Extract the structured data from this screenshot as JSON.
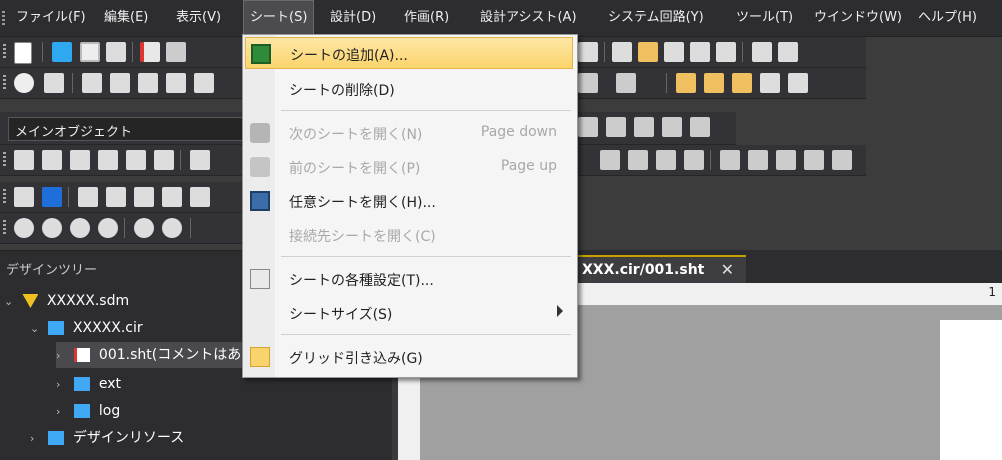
{
  "menubar": {
    "items": [
      "ファイル(F)",
      "編集(E)",
      "表示(V)",
      "シート(S)",
      "設計(D)",
      "作画(R)",
      "設計アシスト(A)",
      "システム回路(Y)",
      "ツール(T)",
      "ウインドウ(W)",
      "ヘルプ(H)"
    ],
    "active_index": 3
  },
  "toolbar": {
    "object_combo": "メインオブジェクト"
  },
  "sheet_menu": {
    "items": [
      {
        "label": "シートの追加(A)...",
        "icon": "add-sheet-icon",
        "enabled": true,
        "highlighted": true
      },
      {
        "label": "シートの削除(D)",
        "enabled": true
      },
      {
        "label": "次のシートを開く(N)",
        "shortcut": "Page down",
        "icon": "next-sheet-icon",
        "enabled": false
      },
      {
        "label": "前のシートを開く(P)",
        "shortcut": "Page up",
        "icon": "prev-sheet-icon",
        "enabled": false
      },
      {
        "label": "任意シートを開く(H)...",
        "icon": "open-sheet-icon",
        "enabled": true
      },
      {
        "label": "接続先シートを開く(C)",
        "enabled": false
      },
      {
        "label": "シートの各種設定(T)...",
        "icon": "sheet-settings-icon",
        "enabled": true
      },
      {
        "label": "シートサイズ(S)",
        "enabled": true,
        "submenu": true
      },
      {
        "label": "グリッド引き込み(G)",
        "icon": "grid-snap-icon",
        "enabled": true
      }
    ]
  },
  "design_tree": {
    "title": "デザインツリー",
    "nodes": [
      {
        "label": "XXXXX.sdm"
      },
      {
        "label": "XXXXX.cir"
      },
      {
        "label": "001.sht(コメントはあ"
      },
      {
        "label": "ext"
      },
      {
        "label": "log"
      },
      {
        "label": "デザインリソース"
      }
    ]
  },
  "document": {
    "tab_label": "XXX.cir/001.sht",
    "close_glyph": "✕",
    "ruler_number": "1"
  },
  "colors": {
    "highlight": "#fbd46b",
    "folder": "#3fa9f5",
    "accent_tab": "#c5a000"
  }
}
